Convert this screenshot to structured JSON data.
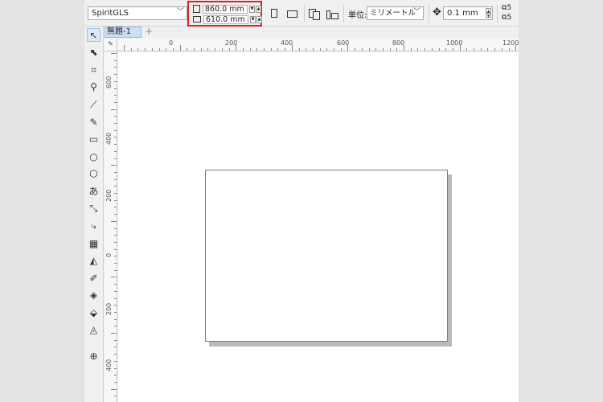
{
  "property_bar": {
    "preset": "SpiritGLS",
    "width_value": "860.0 mm",
    "height_value": "610.0 mm",
    "units_label": "単位:",
    "units_value": "ミリメートル",
    "nudge_value": "0.1 mm",
    "duplicate_values": [
      "5",
      "5"
    ]
  },
  "document": {
    "tab_label": "無題-1",
    "add_tab": "+"
  },
  "rulers": {
    "corner_icon": "✎",
    "horizontal_labels": [
      "0",
      "200",
      "400",
      "600",
      "800",
      "1000",
      "1200"
    ],
    "vertical_labels": [
      "600",
      "400",
      "200",
      "0",
      "200",
      "400"
    ]
  },
  "icons": {
    "highlight_color": "#e41e1e"
  }
}
